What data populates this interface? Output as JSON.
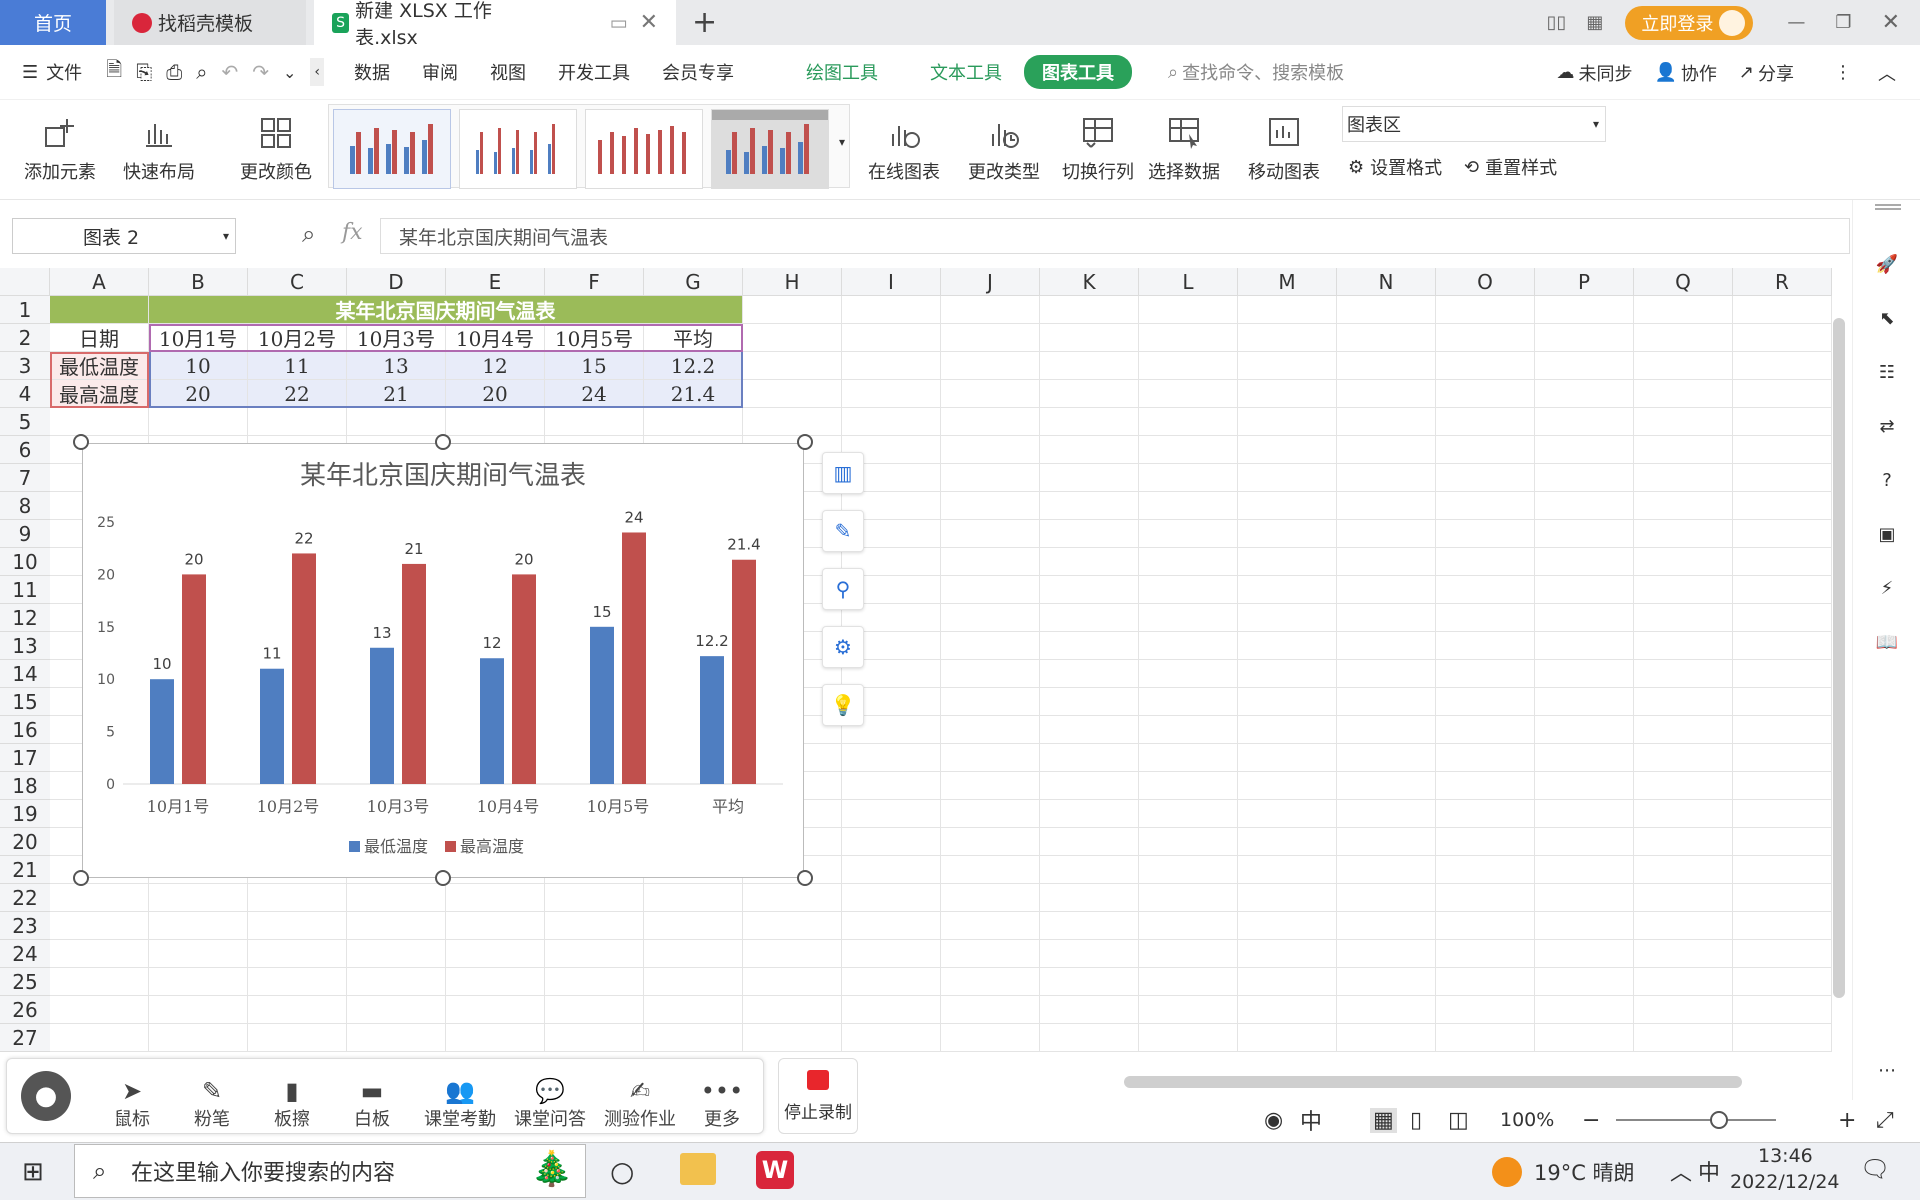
{
  "tabs": {
    "home": "首页",
    "template": "找稻壳模板",
    "doc": "新建 XLSX 工作表.xlsx",
    "add": "+"
  },
  "titlebar": {
    "login": "立即登录"
  },
  "menu": {
    "file": "文件",
    "items": [
      "数据",
      "审阅",
      "视图",
      "开发工具",
      "会员专享"
    ],
    "draw_tools": "绘图工具",
    "text_tools": "文本工具",
    "chart_tools": "图表工具",
    "search_placeholder": "查找命令、搜索模板",
    "unsync": "未同步",
    "collab": "协作",
    "share": "分享"
  },
  "ribbon": {
    "add_element": "添加元素",
    "quick_layout": "快速布局",
    "change_color": "更改颜色",
    "online_chart": "在线图表",
    "change_type": "更改类型",
    "switch_rowcol": "切换行列",
    "select_data": "选择数据",
    "move_chart": "移动图表",
    "chart_area": "图表区",
    "set_format": "设置格式",
    "reset_style": "重置样式"
  },
  "formula": {
    "namebox": "图表 2",
    "fx": "fx",
    "value": "某年北京国庆期间气温表"
  },
  "columns": [
    "A",
    "B",
    "C",
    "D",
    "E",
    "F",
    "G",
    "H",
    "I",
    "J",
    "K",
    "L",
    "M",
    "N",
    "O",
    "P",
    "Q",
    "R"
  ],
  "rows": [
    "1",
    "2",
    "3",
    "4",
    "5",
    "6",
    "7",
    "8",
    "9",
    "10",
    "11",
    "12",
    "13",
    "14",
    "15",
    "16",
    "17",
    "18",
    "19",
    "20",
    "21",
    "22",
    "23",
    "24",
    "25",
    "26",
    "27"
  ],
  "table": {
    "title": "某年北京国庆期间气温表",
    "header": [
      "日期",
      "10月1号",
      "10月2号",
      "10月3号",
      "10月4号",
      "10月5号",
      "平均"
    ],
    "low": [
      "最低温度",
      "10",
      "11",
      "13",
      "12",
      "15",
      "12.2"
    ],
    "high": [
      "最高温度",
      "20",
      "22",
      "21",
      "20",
      "24",
      "21.4"
    ]
  },
  "chart_data": {
    "type": "bar",
    "title": "某年北京国庆期间气温表",
    "categories": [
      "10月1号",
      "10月2号",
      "10月3号",
      "10月4号",
      "10月5号",
      "平均"
    ],
    "series": [
      {
        "name": "最低温度",
        "values": [
          10,
          11,
          13,
          12,
          15,
          12.2
        ],
        "color": "#4f7ec1"
      },
      {
        "name": "最高温度",
        "values": [
          20,
          22,
          21,
          20,
          24,
          21.4
        ],
        "color": "#c0504d"
      }
    ],
    "yticks": [
      "0",
      "5",
      "10",
      "15",
      "20",
      "25"
    ],
    "ylim": [
      0,
      25
    ],
    "legend": "bottom"
  },
  "classroom": {
    "tools": [
      "鼠标",
      "粉笔",
      "板擦",
      "白板",
      "课堂考勤",
      "课堂问答",
      "测验作业",
      "更多"
    ],
    "stop": "停止录制"
  },
  "statusbar": {
    "zoom": "100%",
    "ime": "中"
  },
  "taskbar": {
    "search": "在这里输入你要搜索的内容",
    "weather": "19°C  晴朗",
    "ime": "中",
    "time": "13:46",
    "date": "2022/12/24"
  }
}
